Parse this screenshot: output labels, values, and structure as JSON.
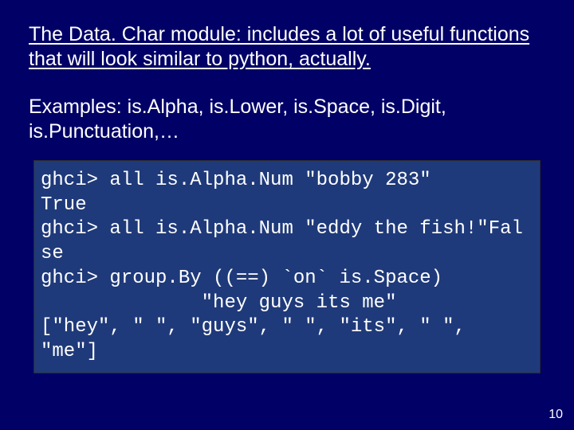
{
  "slide": {
    "title": "The Data. Char module: includes a lot of useful functions that will look similar to python, actually.",
    "examples": "Examples: is.Alpha, is.Lower, is.Space, is.Digit, is.Punctuation,…",
    "code": "ghci> all is.Alpha.Num \"bobby 283\"\nTrue\nghci> all is.Alpha.Num \"eddy the fish!\"Fal\nse\nghci> group.By ((==) `on` is.Space)\n              \"hey guys its me\"\n[\"hey\", \" \", \"guys\", \" \", \"its\", \" \", \"me\"]",
    "page_number": "10"
  }
}
